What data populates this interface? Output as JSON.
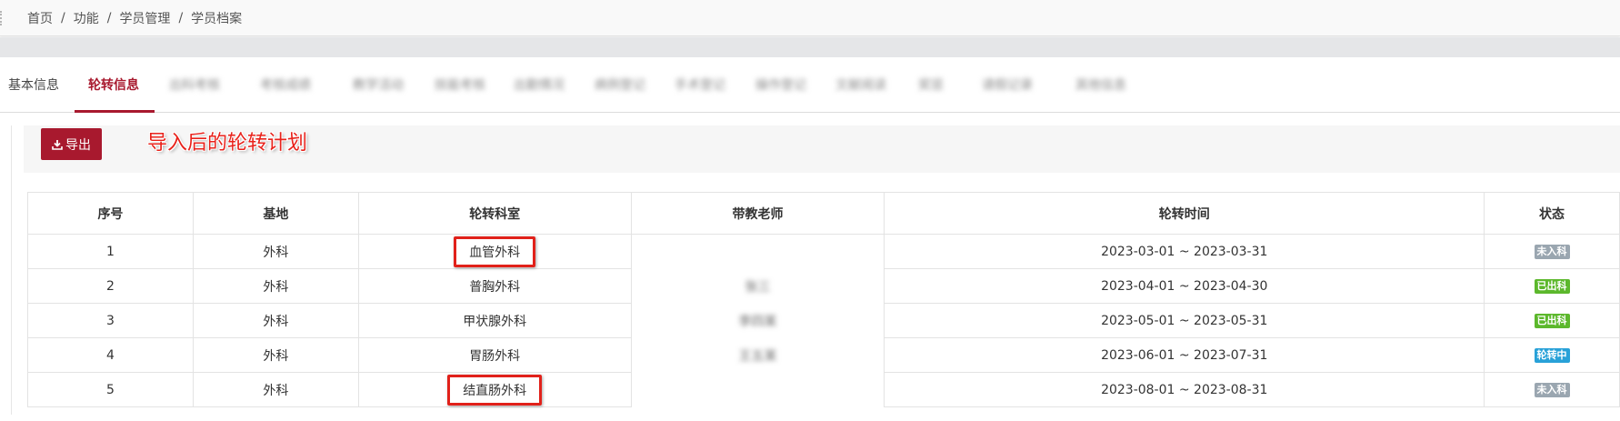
{
  "breadcrumb": [
    "首页",
    "功能",
    "学员管理",
    "学员档案"
  ],
  "breadcrumb_separator": "/",
  "tabs": [
    {
      "label": "基本信息",
      "active": false
    },
    {
      "label": "轮转信息",
      "active": true
    },
    {
      "label": "出科考核",
      "active": false,
      "blurred": true
    },
    {
      "label": "考核成绩",
      "active": false,
      "blurred": true
    },
    {
      "label": "教学活动",
      "active": false,
      "blurred": true
    },
    {
      "label": "技能考核",
      "active": false,
      "blurred": true
    },
    {
      "label": "出勤情况",
      "active": false,
      "blurred": true
    },
    {
      "label": "病例登记",
      "active": false,
      "blurred": true
    },
    {
      "label": "手术登记",
      "active": false,
      "blurred": true
    },
    {
      "label": "操作登记",
      "active": false,
      "blurred": true
    },
    {
      "label": "文献阅读",
      "active": false,
      "blurred": true
    },
    {
      "label": "奖惩",
      "active": false,
      "blurred": true
    },
    {
      "label": "请假记录",
      "active": false,
      "blurred": true
    },
    {
      "label": "其他信息",
      "active": false,
      "blurred": true
    }
  ],
  "toolbar": {
    "export_label": "导出"
  },
  "annotation": "导入后的轮转计划",
  "table": {
    "headers": [
      "序号",
      "基地",
      "轮转科室",
      "带教老师",
      "轮转时间",
      "状态"
    ],
    "rows": [
      {
        "idx": "1",
        "base": "外科",
        "dept": "血管外科",
        "teacher": "",
        "time": "2023-03-01 ~ 2023-03-31",
        "status": "未入科",
        "highlight": true
      },
      {
        "idx": "2",
        "base": "外科",
        "dept": "普胸外科",
        "teacher": "张三",
        "time": "2023-04-01 ~ 2023-04-30",
        "status": "已出科",
        "highlight": false
      },
      {
        "idx": "3",
        "base": "外科",
        "dept": "甲状腺外科",
        "teacher": "李四某",
        "time": "2023-05-01 ~ 2023-05-31",
        "status": "已出科",
        "highlight": false
      },
      {
        "idx": "4",
        "base": "外科",
        "dept": "胃肠外科",
        "teacher": "王五某",
        "time": "2023-06-01 ~ 2023-07-31",
        "status": "轮转中",
        "highlight": false
      },
      {
        "idx": "5",
        "base": "外科",
        "dept": "结直肠外科",
        "teacher": "",
        "time": "2023-08-01 ~ 2023-08-31",
        "status": "未入科",
        "highlight": true
      }
    ]
  },
  "status_colors": {
    "未入科": "#9aa6b0",
    "已出科": "#5cb82c",
    "轮转中": "#28a1d8"
  },
  "accent_color": "#a8192e",
  "annotation_color": "#e8221b"
}
